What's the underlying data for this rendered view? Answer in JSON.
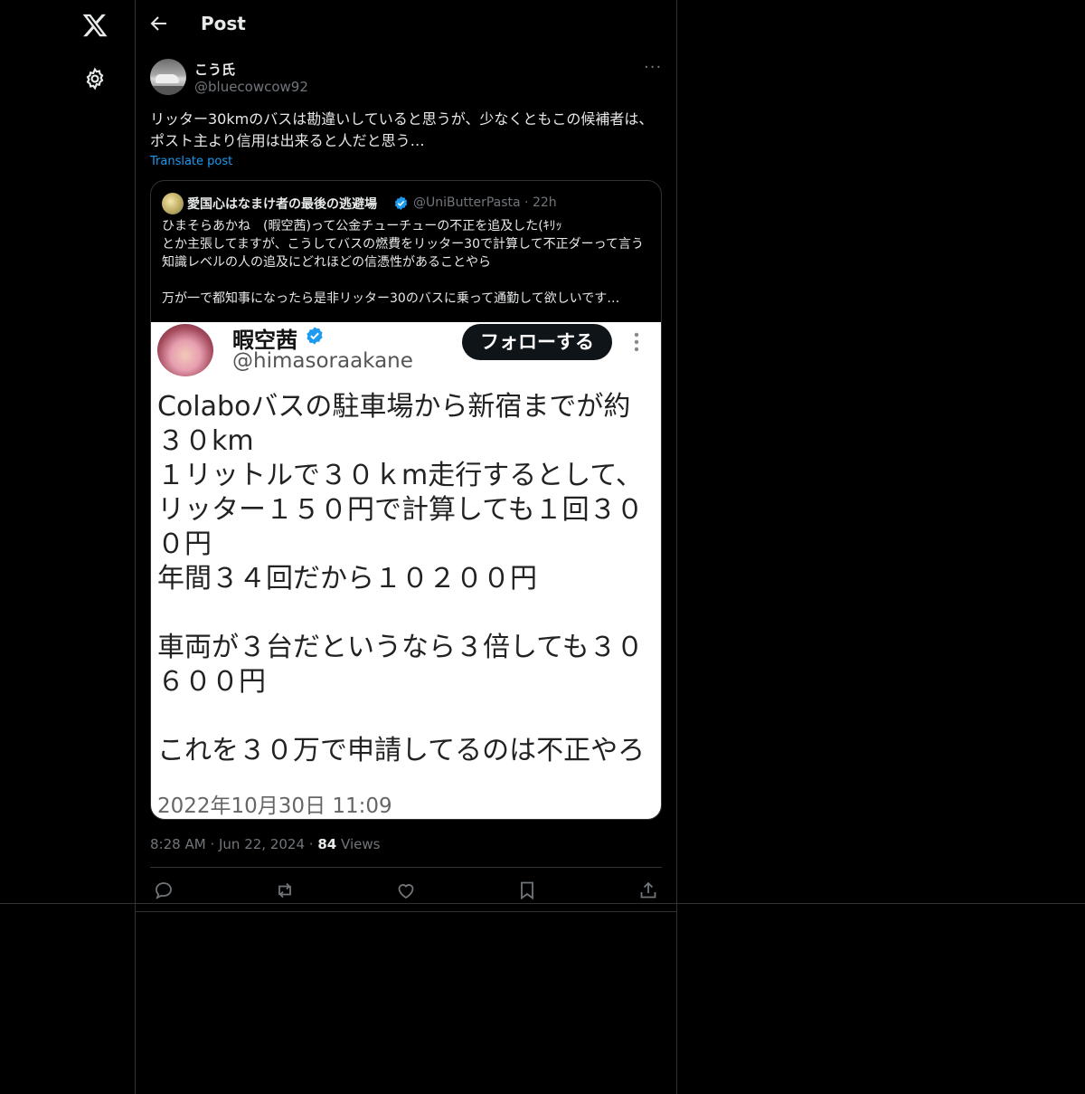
{
  "nav": {
    "logo_icon": "x-logo-icon",
    "settings_icon": "gear-icon"
  },
  "header": {
    "title": "Post",
    "back_icon": "arrow-left-icon"
  },
  "post": {
    "author_name": "こう氏",
    "author_handle": "@bluecowcow92",
    "more_label": "···",
    "text": "リッター30kmのバスは勘違いしていると思うが、少なくともこの候補者は、ポスト主より信用は出来ると人だと思う…",
    "translate_label": "Translate post",
    "time": "8:28 AM",
    "date": "Jun 22, 2024",
    "views_count": "84",
    "views_label": "Views",
    "dot": "·"
  },
  "quote": {
    "author_name": "愛国心はなまけ者の最後の逃避場",
    "author_handle": "@UniButterPasta",
    "age": "22h",
    "dot": "·",
    "text": "ひまそらあかね　(暇空茜)って公金チューチューの不正を追及した(ｷﾘｯ\nとか主張してますが、こうしてバスの燃費をリッター30で計算して不正ダーって言う知識レベルの人の追及にどれほどの信憑性があることやら\n\n万が一で都知事になったら是非リッター30のバスに乗って通勤して欲しいです…",
    "image": {
      "name": "暇空茜",
      "handle": "@himasoraakane",
      "follow_label": "フォローする",
      "body": "Colaboバスの駐車場から新宿までが約３０km\n１リットルで３０ｋm走行するとして、リッター１５０円で計算しても１回３００円\n年間３４回だから１０２００円\n\n車両が３台だというなら３倍しても３０６００円\n\nこれを３０万で申請してるのは不正やろ",
      "date": "2022年10月30日 11:09"
    }
  },
  "actions": [
    "reply-icon",
    "repost-icon",
    "like-icon",
    "bookmark-icon",
    "share-icon"
  ],
  "colors": {
    "background": "#000000",
    "text": "#e7e9ea",
    "muted": "#71767b",
    "accent": "#1d9bf0",
    "border": "#2f3336"
  }
}
